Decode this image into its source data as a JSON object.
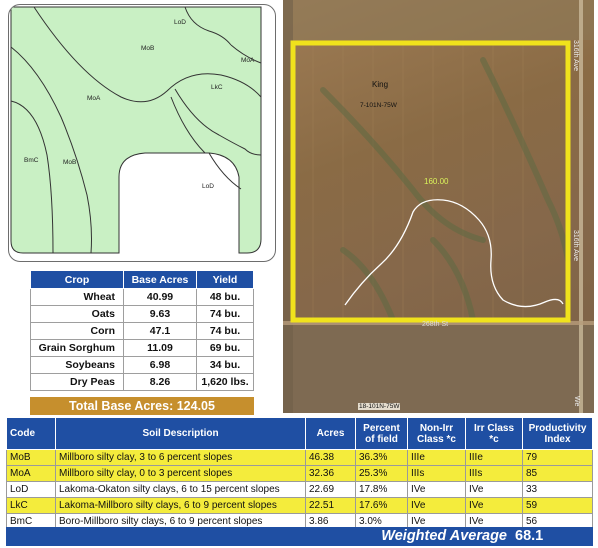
{
  "soil_map": {
    "labels": {
      "lod_top": "LoD",
      "mob_top": "MoB",
      "moa_right": "MoA",
      "lkc": "LkC",
      "moa_mid": "MoA",
      "bmc": "BmC",
      "mob_left": "MoB",
      "lod_bottom": "LoD"
    },
    "fill_color": "#c9f0c4",
    "line_color": "#333333"
  },
  "crop_table": {
    "headers": {
      "crop": "Crop",
      "base_acres": "Base Acres",
      "yield": "Yield"
    },
    "rows": [
      {
        "crop": "Wheat",
        "base_acres": "40.99",
        "yield": "48 bu."
      },
      {
        "crop": "Oats",
        "base_acres": "9.63",
        "yield": "74 bu."
      },
      {
        "crop": "Corn",
        "base_acres": "47.1",
        "yield": "74 bu."
      },
      {
        "crop": "Grain Sorghum",
        "base_acres": "11.09",
        "yield": "69 bu."
      },
      {
        "crop": "Soybeans",
        "base_acres": "6.98",
        "yield": "34 bu."
      },
      {
        "crop": "Dry Peas",
        "base_acres": "8.26",
        "yield": "1,620 lbs."
      }
    ],
    "total_label": "Total Base Acres:  124.05",
    "header_color": "#1f4fa3",
    "total_color": "#c68f2d"
  },
  "aerial": {
    "county": "King",
    "legal": "7-101N-75W",
    "acres": "160.00",
    "road_right": "316th Ave",
    "road_right_lower": "316th Ave",
    "road_bottom": "268th St",
    "legal_bottom": "18-101N-75W",
    "corner_bottom": "We",
    "boundary_color": "#f0e21c"
  },
  "soil_table": {
    "headers": {
      "code": "Code",
      "description": "Soil Description",
      "acres": "Acres",
      "percent": "Percent of field",
      "nonirr": "Non-Irr Class *c",
      "irr": "Irr Class *c",
      "productivity": "Productivity Index"
    },
    "rows": [
      {
        "code": "MoB",
        "description": "Millboro silty clay, 3 to 6 percent slopes",
        "acres": "46.38",
        "percent": "36.3%",
        "nonirr": "IIIe",
        "irr": "IIIe",
        "productivity": "79",
        "highlight": true
      },
      {
        "code": "MoA",
        "description": "Millboro silty clay, 0 to 3 percent slopes",
        "acres": "32.36",
        "percent": "25.3%",
        "nonirr": "IIIs",
        "irr": "IIIs",
        "productivity": "85",
        "highlight": true
      },
      {
        "code": "LoD",
        "description": "Lakoma-Okaton silty clays, 6 to 15 percent slopes",
        "acres": "22.69",
        "percent": "17.8%",
        "nonirr": "IVe",
        "irr": "IVe",
        "productivity": "33",
        "highlight": false
      },
      {
        "code": "LkC",
        "description": "Lakoma-Millboro silty clays, 6 to 9 percent slopes",
        "acres": "22.51",
        "percent": "17.6%",
        "nonirr": "IVe",
        "irr": "IVe",
        "productivity": "59",
        "highlight": true
      },
      {
        "code": "BmC",
        "description": "Boro-Millboro silty clays, 6 to 9 percent slopes",
        "acres": "3.86",
        "percent": "3.0%",
        "nonirr": "IVe",
        "irr": "IVe",
        "productivity": "56",
        "highlight": false
      }
    ],
    "weighted_label": "Weighted Average",
    "weighted_value": "68.1",
    "highlight_color": "#f4ec3c"
  }
}
